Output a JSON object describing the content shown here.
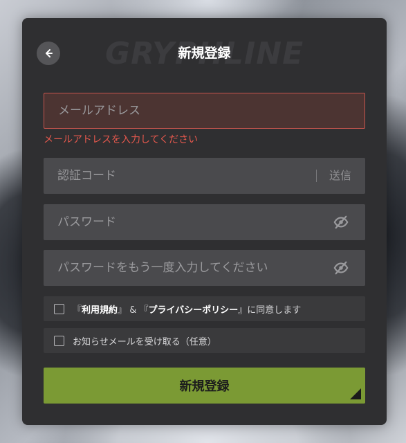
{
  "header": {
    "title": "新規登録",
    "watermark": "GRYPHLINE"
  },
  "form": {
    "email": {
      "placeholder": "メールアドレス",
      "value": "",
      "error": "メールアドレスを入力してください"
    },
    "code": {
      "placeholder": "認証コード",
      "value": "",
      "send_label": "送信"
    },
    "password": {
      "placeholder": "パスワード",
      "value": ""
    },
    "password_confirm": {
      "placeholder": "パスワードをもう一度入力してください",
      "value": ""
    },
    "agree": {
      "checked": false,
      "bracket_open_1": "『",
      "terms_label": "利用規約",
      "bracket_close_1": "』",
      "amp": "&",
      "bracket_open_2": "『",
      "privacy_label": "プライバシーポリシー",
      "bracket_close_2": "』",
      "suffix": "に同意します"
    },
    "newsletter": {
      "checked": false,
      "label": "お知らせメールを受け取る（任意）"
    },
    "submit_label": "新規登録"
  },
  "icons": {
    "back": "arrow-left-icon",
    "eye_hidden": "eye-off-icon"
  },
  "colors": {
    "panel": "#2f2f31",
    "field": "#4a4a4d",
    "error": "#e5584d",
    "accent": "#7b9a34"
  }
}
